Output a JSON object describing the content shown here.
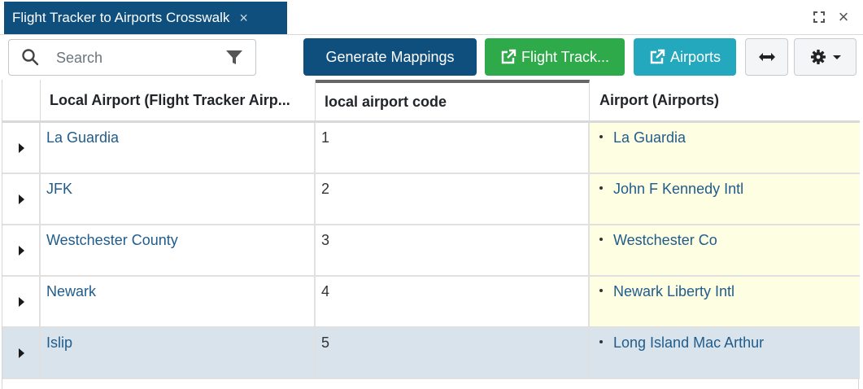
{
  "tab": {
    "title": "Flight Tracker to Airports Crosswalk",
    "close_glyph": "×"
  },
  "window": {
    "expand_icon": "expand-icon",
    "close_glyph": "×"
  },
  "toolbar": {
    "search_placeholder": "Search",
    "generate_label": "Generate Mappings",
    "flight_label": "Flight Track...",
    "airports_label": "Airports"
  },
  "colors": {
    "primary": "#0e4f7d",
    "success": "#2eaa4a",
    "info": "#24a8be",
    "link": "#1f5c8c",
    "highlight": "#fefee2",
    "selected_row": "#d9e3ec"
  },
  "grid": {
    "columns": [
      "Local Airport (Flight Tracker Airp...",
      "local airport code",
      "Airport (Airports)"
    ],
    "rows": [
      {
        "local": "La Guardia",
        "code": "1",
        "airport": "La Guardia"
      },
      {
        "local": "JFK",
        "code": "2",
        "airport": "John F Kennedy Intl"
      },
      {
        "local": "Westchester County",
        "code": "3",
        "airport": "Westchester Co"
      },
      {
        "local": "Newark",
        "code": "4",
        "airport": "Newark Liberty Intl"
      },
      {
        "local": "Islip",
        "code": "5",
        "airport": "Long Island Mac Arthur"
      }
    ]
  }
}
